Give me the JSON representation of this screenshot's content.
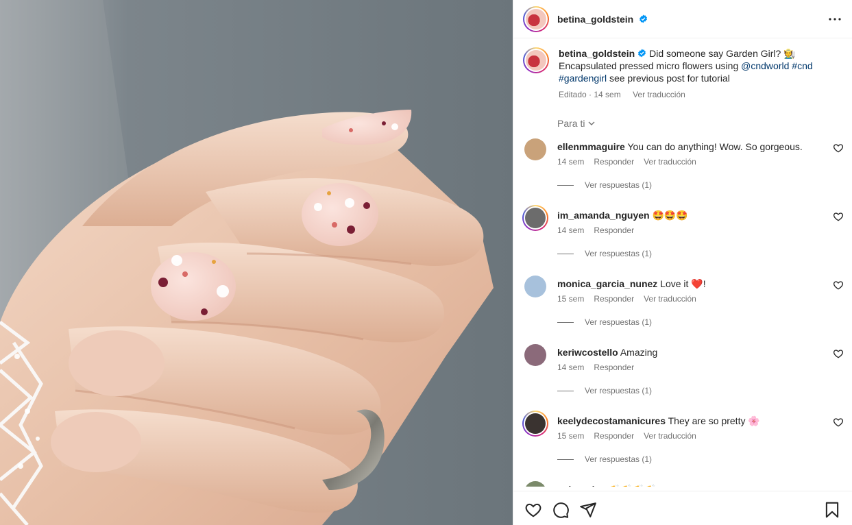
{
  "header": {
    "username": "betina_goldstein",
    "more_icon": "more-horizontal-icon"
  },
  "caption": {
    "username": "betina_goldstein",
    "text_1": "Did someone say Garden Girl? 🧑‍🌾",
    "text_2": "Encapsulated pressed micro flowers using ",
    "mention": "@cndworld",
    "hashtag_1": "#cnd",
    "hashtag_2": "#gardengirl",
    "text_3": " see previous post for tutorial",
    "edited": "Editado",
    "separator": " · ",
    "time": "14 sem",
    "translate": "Ver traducción"
  },
  "for_you": {
    "label": "Para ti"
  },
  "comments": [
    {
      "username": "ellenmmaguire",
      "text": "You can do anything! Wow. So gorgeous.",
      "time": "14 sem",
      "reply": "Responder",
      "translate": "Ver traducción",
      "replies": "Ver respuestas (1)",
      "has_story": false,
      "avatar_color": "#c9a27a"
    },
    {
      "username": "im_amanda_nguyen",
      "text": "🤩🤩🤩",
      "time": "14 sem",
      "reply": "Responder",
      "translate": "",
      "replies": "Ver respuestas (1)",
      "has_story": true,
      "avatar_color": "#6c6c6c"
    },
    {
      "username": "monica_garcia_nunez",
      "text": "Love it ❤️!",
      "time": "15 sem",
      "reply": "Responder",
      "translate": "Ver traducción",
      "replies": "Ver respuestas (1)",
      "has_story": false,
      "avatar_color": "#a7c1dc"
    },
    {
      "username": "keriwcostello",
      "text": "Amazing",
      "time": "14 sem",
      "reply": "Responder",
      "translate": "",
      "replies": "Ver respuestas (1)",
      "has_story": false,
      "avatar_color": "#8b6a7a"
    },
    {
      "username": "keelydecostamanicures",
      "text": "They are so pretty 🌸",
      "time": "15 sem",
      "reply": "Responder",
      "translate": "Ver traducción",
      "replies": "Ver respuestas (1)",
      "has_story": true,
      "avatar_color": "#3a3330"
    },
    {
      "username": "galvezclau",
      "text": "👏👏👏👏",
      "time": "",
      "reply": "",
      "translate": "",
      "replies": "",
      "has_story": false,
      "avatar_color": "#7b8a6a"
    }
  ],
  "actions": {
    "like_icon": "heart-icon",
    "comment_icon": "comment-icon",
    "share_icon": "send-icon",
    "save_icon": "bookmark-icon"
  },
  "colors": {
    "link": "#00376b",
    "verified": "#0095f6",
    "secondary_text": "#737373",
    "border": "#efefef"
  }
}
